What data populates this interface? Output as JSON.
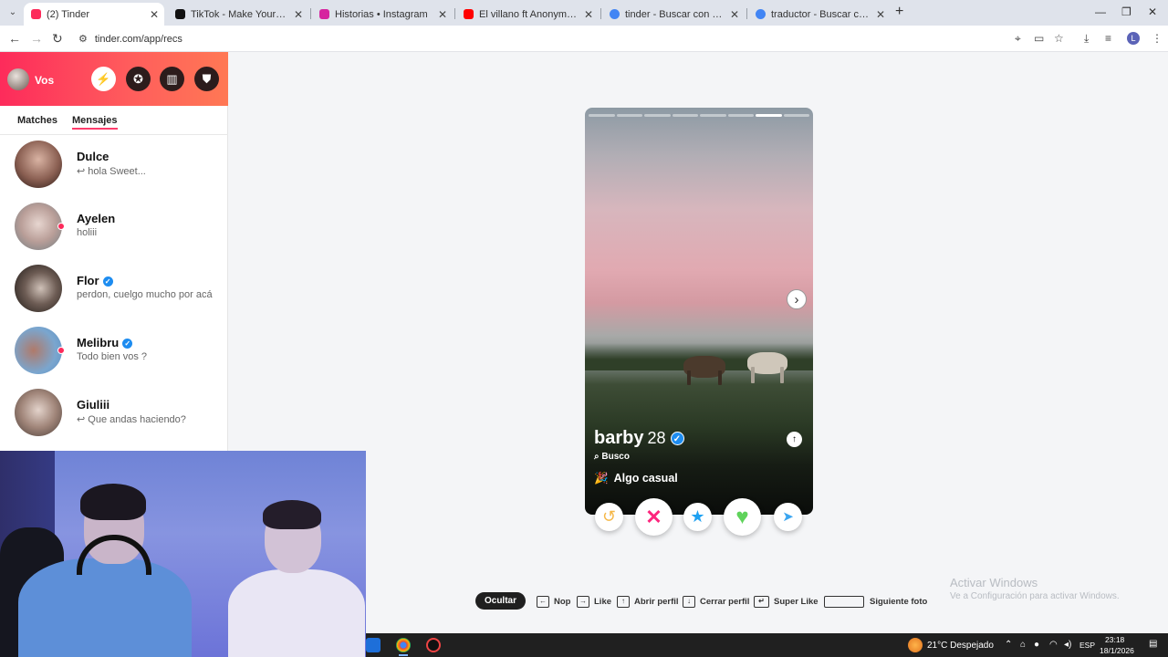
{
  "browser": {
    "tabs": [
      {
        "title": "(2) Tinder",
        "color": "#fd2b5b"
      },
      {
        "title": "TikTok - Make Your Day",
        "color": "#111111"
      },
      {
        "title": "Historias • Instagram",
        "color": "#d6249f"
      },
      {
        "title": "El villano ft Anonymous - El tele",
        "color": "#ff0000"
      },
      {
        "title": "tinder - Buscar con Google",
        "color": "#4285f4"
      },
      {
        "title": "traductor - Buscar con Google",
        "color": "#4285f4"
      }
    ],
    "url": "tinder.com/app/recs",
    "profile_initial": "L"
  },
  "sidebar": {
    "user_name": "Vos",
    "tabs": [
      "Matches",
      "Mensajes"
    ],
    "messages": [
      {
        "name": "Dulce",
        "preview": "↩ hola Sweet...",
        "verified": false,
        "online": false
      },
      {
        "name": "Ayelen",
        "preview": "holiii",
        "verified": false,
        "online": true
      },
      {
        "name": "Flor",
        "preview": "perdon, cuelgo mucho por acá",
        "verified": true,
        "online": false
      },
      {
        "name": "Melibru",
        "preview": "Todo bien vos ?",
        "verified": true,
        "online": true
      },
      {
        "name": "Giuliii",
        "preview": "↩ Que andas haciendo?",
        "verified": false,
        "online": false
      }
    ]
  },
  "card": {
    "name": "barby",
    "age": "28",
    "looking_label": "Busco",
    "relationship": "Algo casual",
    "photo_count": 8,
    "photo_index": 7
  },
  "shortcuts": {
    "hide": "Ocultar",
    "nope": "Nop",
    "like": "Like",
    "open_profile": "Abrir perfil",
    "close_profile": "Cerrar perfil",
    "super_like": "Super Like",
    "next_photo": "Siguiente foto"
  },
  "watermark": {
    "title": "Activar Windows",
    "subtitle": "Ve a Configuración para activar Windows."
  },
  "taskbar": {
    "weather": "21°C  Despejado",
    "lang": "ESP",
    "time": "23:18",
    "date": "18/1/2026"
  }
}
